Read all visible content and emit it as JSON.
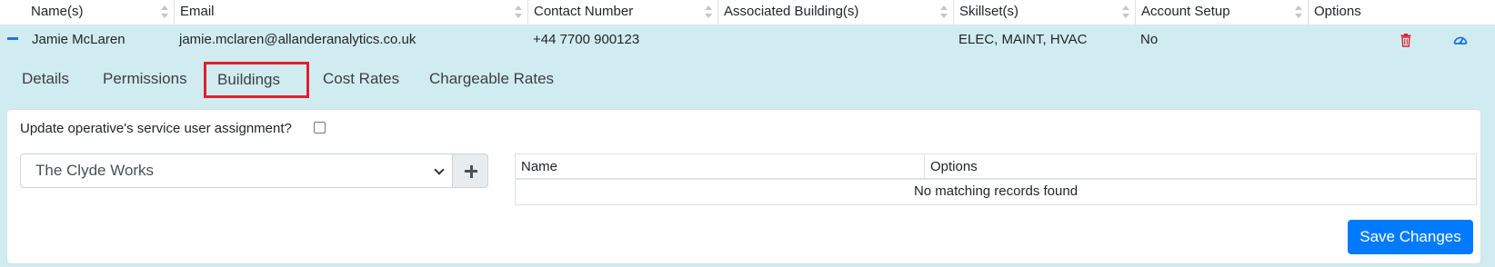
{
  "table": {
    "columns": [
      "Name(s)",
      "Email",
      "Contact Number",
      "Associated Building(s)",
      "Skillset(s)",
      "Account Setup",
      "Options"
    ],
    "row": {
      "name": "Jamie McLaren",
      "email": "jamie.mclaren@allanderanalytics.co.uk",
      "contact_number": "+44 7700 900123",
      "associated_buildings": "",
      "skillsets": "ELEC, MAINT, HVAC",
      "account_setup": "No"
    }
  },
  "tabs": [
    "Details",
    "Permissions",
    "Buildings",
    "Cost Rates",
    "Chargeable Rates"
  ],
  "active_tab": "Buildings",
  "buildings_panel": {
    "checkbox_label": "Update operative's service user assignment?",
    "checkbox_checked": false,
    "select_value": "The Clyde Works",
    "table_columns": [
      "Name",
      "Options"
    ],
    "empty_message": "No matching records found",
    "save_label": "Save Changes"
  },
  "colors": {
    "expanded_bg": "#d1ecf1",
    "active_tab_border": "#e1202a",
    "primary": "#007bff",
    "delete_icon": "#e1202a",
    "dashboard_icon": "#1a73e8"
  },
  "icons": {
    "collapse": "minus-icon",
    "delete": "trash-icon",
    "dashboard": "gauge-icon",
    "add": "plus-icon",
    "select": "chevron-down-icon"
  }
}
